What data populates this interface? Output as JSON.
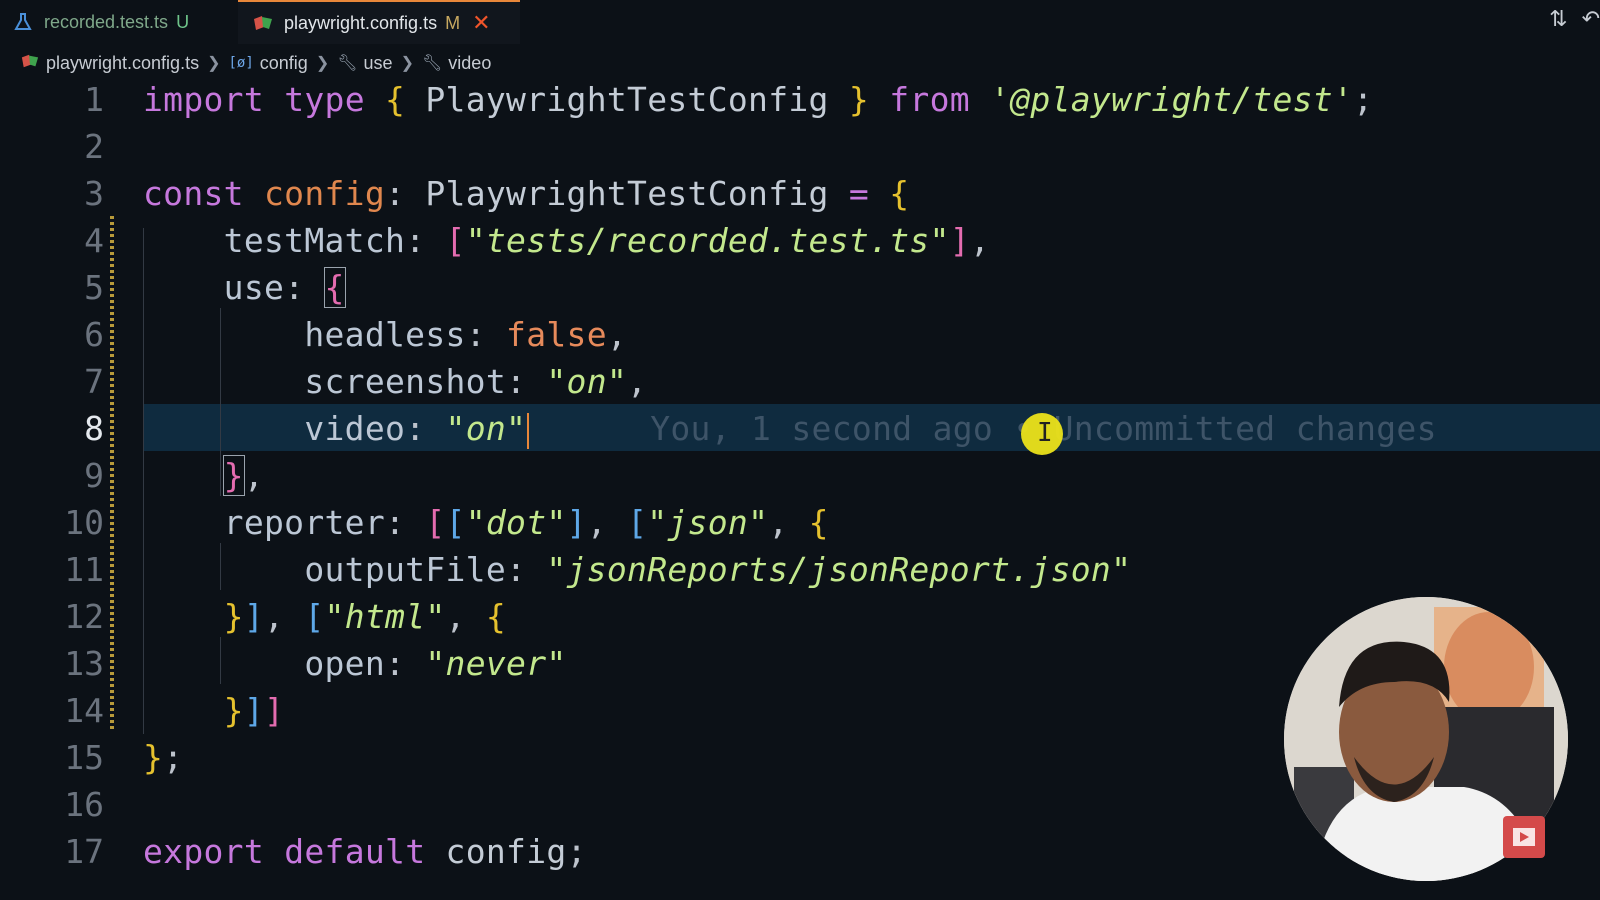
{
  "tabs": [
    {
      "label": "recorded.test.ts",
      "badge": "U",
      "icon": "flask-icon"
    },
    {
      "label": "playwright.config.ts",
      "badge": "M",
      "icon": "playwright-icon",
      "close": "✕"
    }
  ],
  "breadcrumb": {
    "file": "playwright.config.ts",
    "items": [
      "config",
      "use",
      "video"
    ]
  },
  "line_numbers": [
    "1",
    "2",
    "3",
    "4",
    "5",
    "6",
    "7",
    "8",
    "9",
    "10",
    "11",
    "12",
    "13",
    "14",
    "15",
    "16",
    "17"
  ],
  "active_line": "8",
  "blame": "You, 1 second ago • Uncommitted changes",
  "code": {
    "l1": {
      "kw1": "import",
      "kw2": "type",
      "ob": "{",
      "type": "PlaywrightTestConfig",
      "cb": "}",
      "kw3": "from",
      "str": "'@playwright/test'",
      "semi": ";"
    },
    "l3": {
      "kw": "const",
      "var": "config",
      "colon": ":",
      "type": "PlaywrightTestConfig",
      "eq": "=",
      "ob": "{"
    },
    "l4": {
      "prop": "testMatch",
      "colon": ":",
      "ob": "[",
      "str": "\"tests/recorded.test.ts\"",
      "cb": "]",
      "comma": ","
    },
    "l5": {
      "prop": "use",
      "colon": ":",
      "ob": "{"
    },
    "l6": {
      "prop": "headless",
      "colon": ":",
      "val": "false",
      "comma": ","
    },
    "l7": {
      "prop": "screenshot",
      "colon": ":",
      "str": "\"on\"",
      "comma": ","
    },
    "l8": {
      "prop": "video",
      "colon": ":",
      "str": "\"on\""
    },
    "l9": {
      "cb": "}",
      "comma": ","
    },
    "l10": {
      "prop": "reporter",
      "colon": ":",
      "ob1": "[",
      "ob2": "[",
      "s1": "\"dot\"",
      "cb2": "]",
      "c1": ",",
      "ob3": "[",
      "s2": "\"json\"",
      "c2": ",",
      "ob4": "{"
    },
    "l11": {
      "prop": "outputFile",
      "colon": ":",
      "str": "\"jsonReports/jsonReport.json\""
    },
    "l12": {
      "cb": "}",
      "cb2": "]",
      "c1": ",",
      "ob": "[",
      "s": "\"html\"",
      "c2": ",",
      "ob2": "{"
    },
    "l13": {
      "prop": "open",
      "colon": ":",
      "str": "\"never\""
    },
    "l14": {
      "cb": "}",
      "cb2": "]",
      "cb3": "]"
    },
    "l15": {
      "cb": "}",
      "semi": ";"
    },
    "l17": {
      "kw1": "export",
      "kw2": "default",
      "id": "config",
      "semi": ";"
    }
  },
  "colors": {
    "accent_tab": "#e8873a",
    "current_line": "#0f2b3f",
    "background": "#0c1117"
  }
}
